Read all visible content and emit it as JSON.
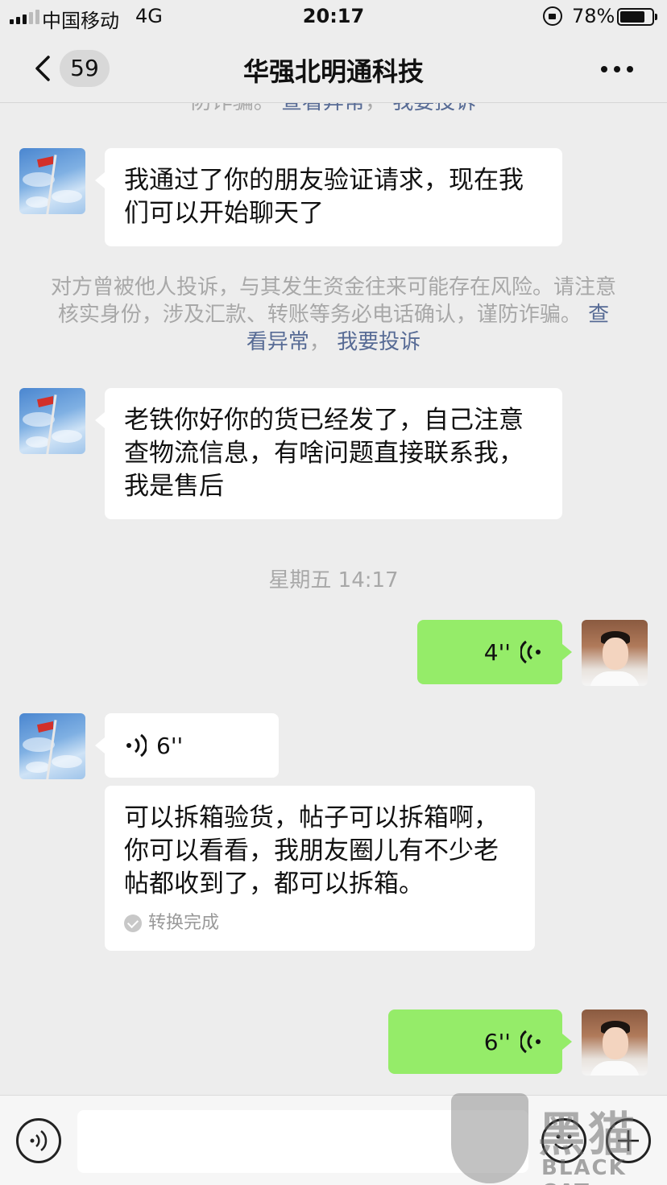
{
  "status_bar": {
    "carrier": "中国移动",
    "network": "4G",
    "time": "20:17",
    "battery_percent": "78%",
    "battery_level": 0.78
  },
  "nav": {
    "unread_count": "59",
    "title": "华强北明通科技"
  },
  "notice_top_partial": {
    "text": "防诈骗。",
    "link_view": "查看异常",
    "separator": "，",
    "link_report": "我要投诉"
  },
  "messages": {
    "m1": {
      "text": "我通过了你的朋友验证请求，现在我们可以开始聊天了"
    },
    "notice": {
      "text": "对方曾被他人投诉，与其发生资金往来可能存在风险。请注意核实身份，涉及汇款、转账等务必电话确认，谨防诈骗。",
      "link_view": "查看异常",
      "separator": "，",
      "link_report": "我要投诉"
    },
    "m2": {
      "text": "老铁你好你的货已经发了，自己注意查物流信息，有啥问题直接联系我，我是售后"
    },
    "timestamp": "星期五 14:17",
    "m3_voice_out": {
      "duration": "4''"
    },
    "m4_voice_in": {
      "duration": "6''"
    },
    "m5_transcript": {
      "text": "可以拆箱验货，帖子可以拆箱啊，你可以看看，我朋友圈儿有不少老帖都收到了，都可以拆箱。",
      "status": "转换完成"
    },
    "m6_voice_out": {
      "duration": "6''"
    }
  },
  "watermark": {
    "cn": "黑猫",
    "en": "BLACK CAT"
  },
  "colors": {
    "background": "#ededed",
    "bubble_out": "#95ec69",
    "bubble_in": "#ffffff",
    "link": "#576b95",
    "notice_text": "#a8a8a8"
  },
  "icons": [
    "back-chevron-icon",
    "more-dots-icon",
    "voice-wave-icon",
    "check-circle-icon",
    "voice-input-icon",
    "emoji-icon",
    "plus-icon"
  ]
}
